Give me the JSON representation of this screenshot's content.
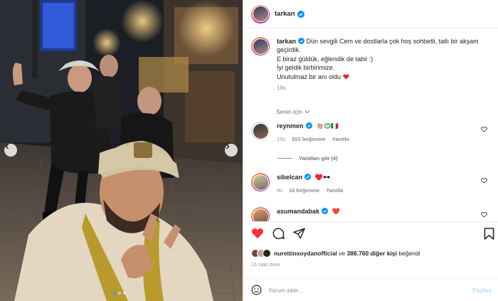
{
  "post": {
    "username": "tarkan",
    "verified": true
  },
  "caption": {
    "username": "tarkan",
    "lines": [
      "Dün sevgili Cem ve dostlarla çok hoş sohbetli, tatlı bir akşam geçirdik.",
      "E biraz güldük, eğlendik de tabii :)",
      "İyi geldik birbirimize.",
      "Unutulmaz bir anı oldu"
    ],
    "time": "16s"
  },
  "filter": {
    "label": "Senin için"
  },
  "comments": [
    {
      "username": "reynmen",
      "text": "👏🏼😊🇮🇹",
      "time": "15s",
      "likes": "203 beğenme",
      "reply": "Yanıtla",
      "verified": true
    },
    {
      "username": "sibelcan",
      "text": "♥️🕶️",
      "time": "9s",
      "likes": "16 beğenme",
      "reply": "Yanıtla",
      "verified": true
    },
    {
      "username": "asumandabak",
      "text": "❤️",
      "verified": true
    }
  ],
  "view_replies": "Yanıtları gör (4)",
  "likes": {
    "first_user": "nurettinsoydanofficial",
    "connector": "ve",
    "count": "386.760 diğer kişi",
    "suffix": "beğendi"
  },
  "posted_ago": "16 saat önce",
  "add_comment": {
    "placeholder": "Yorum ekle...",
    "post_label": "Paylaş"
  },
  "colors": {
    "liked_heart": "#ff3040",
    "verified_badge": "#0095f6",
    "post_button_disabled": "#b3dbff",
    "carousel_dot_active": "#3b96f4"
  }
}
